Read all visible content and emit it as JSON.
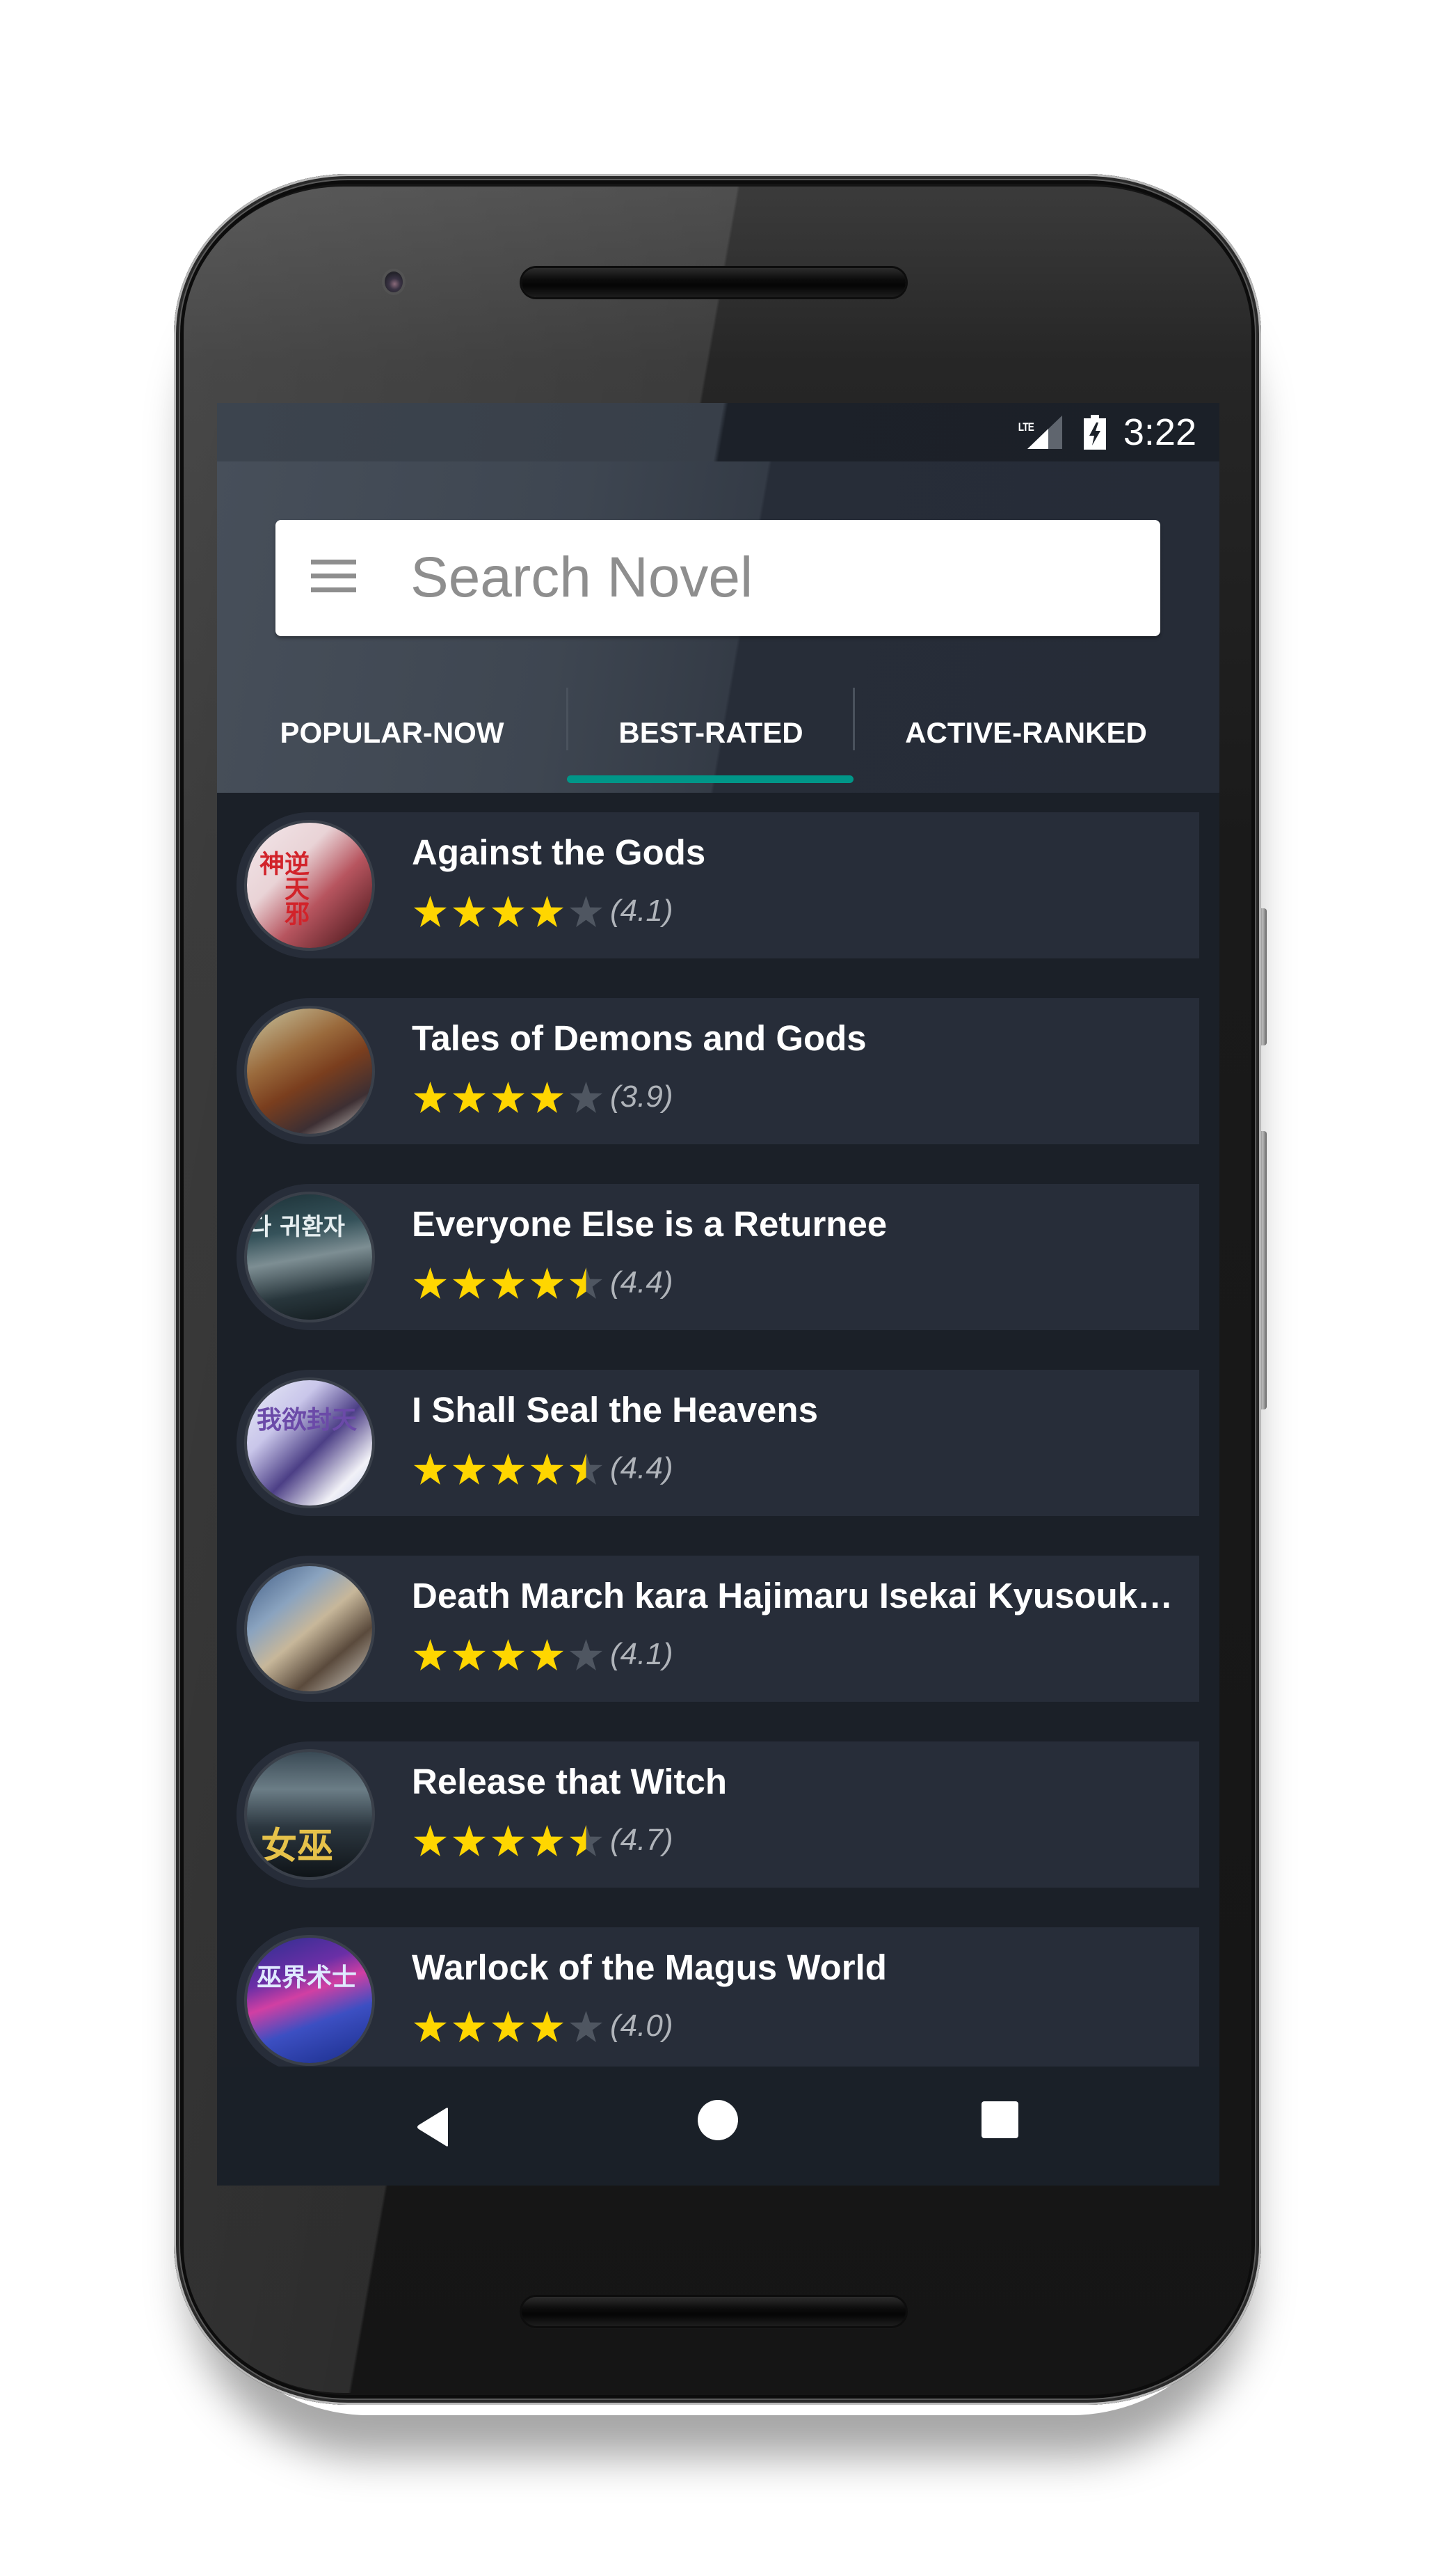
{
  "status_bar": {
    "network_label": "LTE",
    "network_icon": "signal-icon",
    "battery_icon": "battery-charging-icon",
    "time": "3:22"
  },
  "search": {
    "menu_icon": "hamburger-menu-icon",
    "placeholder": "Search Novel",
    "value": ""
  },
  "tabs": [
    {
      "label": "POPULAR-NOW",
      "active": false
    },
    {
      "label": "BEST-RATED",
      "active": true
    },
    {
      "label": "ACTIVE-RANKED",
      "active": false
    }
  ],
  "colors": {
    "accent": "#009688",
    "star_filled": "#FFD600",
    "star_empty": "#4F5661",
    "card_bg": "#272D39",
    "list_bg": "#1B2028"
  },
  "novels": [
    {
      "title": "Against the Gods",
      "rating": 4.1,
      "rating_label": "(4.1)",
      "stars": 4.0,
      "cover": {
        "bg": "linear-gradient(135deg,#f3e7ea 0%,#e9d3d6 35%,#b7555f 60%,#6b2a30 85%,#2a1a1c 100%)",
        "glyph": "逆天邪神",
        "glyph_color": "#d2232a"
      }
    },
    {
      "title": "Tales of Demons and Gods",
      "rating": 3.9,
      "rating_label": "(3.9)",
      "stars": 4.0,
      "cover": {
        "bg": "linear-gradient(150deg,#c9c7a3 0%,#9a6a3c 35%,#7a3e1e 55%,#3d2f33 78%,#d9d6d0 100%)",
        "glyph": "",
        "glyph_color": "#ffffff"
      }
    },
    {
      "title": "Everyone Else is a Returnee",
      "rating": 4.4,
      "rating_label": "(4.4)",
      "stars": 4.5,
      "cover": {
        "bg": "linear-gradient(170deg,#1d3238 0%,#35525a 30%,#7d8e93 50%,#28363c 75%,#121a1d 100%)",
        "glyph": "다 귀환자",
        "glyph_color": "#e6eef0"
      }
    },
    {
      "title": "I Shall Seal the Heavens",
      "rating": 4.4,
      "rating_label": "(4.4)",
      "stars": 4.5,
      "cover": {
        "bg": "linear-gradient(135deg,#e9ecf7 0%,#c9c6ea 30%,#4c3f86 55%,#f1f1f7 80%,#bdc5ea 100%)",
        "glyph": "我欲封天",
        "glyph_color": "#6b4aa8"
      }
    },
    {
      "title": "Death March kara Hajimaru Isekai Kyusoukyoku",
      "rating": 4.1,
      "rating_label": "(4.1)",
      "stars": 4.0,
      "cover": {
        "bg": "linear-gradient(140deg,#3e5a83 0%,#8aa3bf 30%,#c7b79a 50%,#5a4a3c 72%,#d8d4cb 100%)",
        "glyph": "",
        "glyph_color": "#ffffff"
      }
    },
    {
      "title": "Release that Witch",
      "rating": 4.7,
      "rating_label": "(4.7)",
      "stars": 4.5,
      "cover": {
        "bg": "linear-gradient(180deg,#3a4a55 0%,#6b7d86 30%,#2c3740 60%,#0f1418 100%)",
        "glyph": "女巫",
        "glyph_color": "#e6c24a"
      }
    },
    {
      "title": "Warlock of the Magus World",
      "rating": 4.0,
      "rating_label": "(4.0)",
      "stars": 4.0,
      "cover": {
        "bg": "linear-gradient(160deg,#2a2f8f 0%,#6a2fa6 30%,#d13fa3 45%,#3c4fc2 65%,#1a2d8a 100%)",
        "glyph": "巫界术士",
        "glyph_color": "#dfe9ff"
      }
    }
  ],
  "nav_bar": {
    "back_icon": "back-triangle-icon",
    "home_icon": "home-circle-icon",
    "recents_icon": "recents-square-icon"
  }
}
